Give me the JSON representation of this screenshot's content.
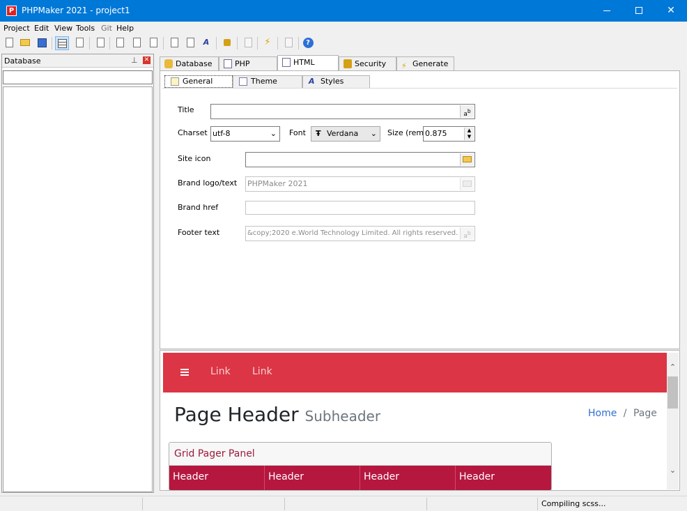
{
  "window": {
    "title": "PHPMaker 2021 - project1",
    "app_icon_letter": "P",
    "min_label": "",
    "max_label": "",
    "close_label": "✕"
  },
  "menu": [
    {
      "label": "Project"
    },
    {
      "label": "Edit"
    },
    {
      "label": "View"
    },
    {
      "label": "Tools"
    },
    {
      "label": "Git"
    },
    {
      "label": "Help"
    }
  ],
  "toolbar": {
    "help_glyph": "?",
    "bolt_glyph": "⚡",
    "text_style_glyph": "A"
  },
  "left_panel": {
    "title": "Database",
    "pin_glyph": "⊥",
    "close_glyph": "✕"
  },
  "tabs": [
    {
      "label": "Database",
      "icon": "database-icon"
    },
    {
      "label": "PHP",
      "icon": "php-file-icon"
    },
    {
      "label": "HTML",
      "icon": "html-file-icon",
      "active": true
    },
    {
      "label": "Security",
      "icon": "lock-icon"
    },
    {
      "label": "Generate",
      "icon": "lightning-icon"
    }
  ],
  "subtabs": [
    {
      "label": "General",
      "active": true
    },
    {
      "label": "Theme"
    },
    {
      "label": "Styles"
    }
  ],
  "form": {
    "title_label": "Title",
    "title_value": "",
    "charset_label": "Charset",
    "charset_value": "utf-8",
    "font_label": "Font",
    "font_value": "Verdana",
    "size_label": "Size (rem)",
    "size_value": "0.875",
    "site_icon_label": "Site icon",
    "site_icon_value": "",
    "brand_label": "Brand logo/text",
    "brand_value": "PHPMaker 2021",
    "brand_href_label": "Brand href",
    "brand_href_value": "",
    "footer_label": "Footer text",
    "footer_value": "&copy;2020 e.World Technology Limited. All rights reserved."
  },
  "preview": {
    "nav_links": [
      "Link",
      "Link"
    ],
    "page_header": "Page Header",
    "subheader": "Subheader",
    "breadcrumb_home": "Home",
    "breadcrumb_sep": "/",
    "breadcrumb_current": "Page",
    "grid_panel_title": "Grid Pager Panel",
    "grid_headers": [
      "Header",
      "Header",
      "Header",
      "Header"
    ],
    "nav_color": "#dc3545",
    "header_row_color": "#b5173f"
  },
  "status": {
    "text": "Compiling scss..."
  },
  "colors": {
    "titlebar": "#0078d7",
    "accent_link": "#2f6fd0"
  }
}
